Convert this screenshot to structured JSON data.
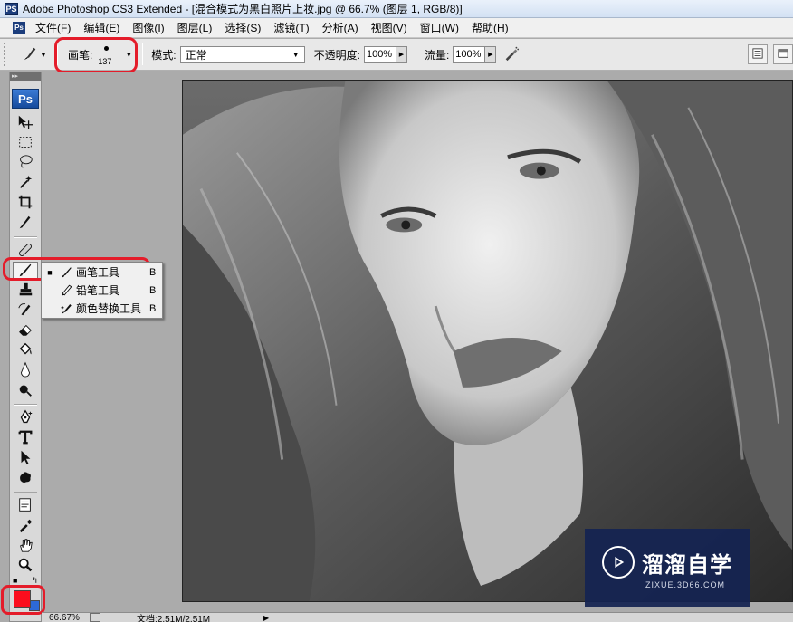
{
  "window": {
    "app_icon": "PS",
    "title": "Adobe Photoshop CS3 Extended - [混合模式为黑白照片上妆.jpg @ 66.7% (图层 1, RGB/8)]"
  },
  "menu": {
    "logo": "Ps",
    "items": [
      "文件(F)",
      "编辑(E)",
      "图像(I)",
      "图层(L)",
      "选择(S)",
      "滤镜(T)",
      "分析(A)",
      "视图(V)",
      "窗口(W)",
      "帮助(H)"
    ]
  },
  "options": {
    "brush_label": "画笔:",
    "brush_size": "137",
    "mode_label": "模式:",
    "mode_value": "正常",
    "opacity_label": "不透明度:",
    "opacity_value": "100%",
    "flow_label": "流量:",
    "flow_value": "100%"
  },
  "toolbox": {
    "logo": "Ps",
    "active_tool": "brush",
    "foreground_color": "#fb0d1d",
    "background_color": "#2d69d6",
    "highlight_color": "#e41c2a"
  },
  "flyout": {
    "items": [
      {
        "bullet": "■",
        "label": "画笔工具",
        "key": "B",
        "icon": "brush-icon",
        "selected": true
      },
      {
        "bullet": "",
        "label": "铅笔工具",
        "key": "B",
        "icon": "pencil-icon",
        "selected": false
      },
      {
        "bullet": "",
        "label": "颜色替换工具",
        "key": "B",
        "icon": "color-replacement-icon",
        "selected": false
      }
    ]
  },
  "watermark": {
    "name": "溜溜自学",
    "url": "ZIXUE.3D66.COM"
  },
  "status": {
    "zoom": "66.67%",
    "doc": "文档:2.51M/2.51M"
  }
}
